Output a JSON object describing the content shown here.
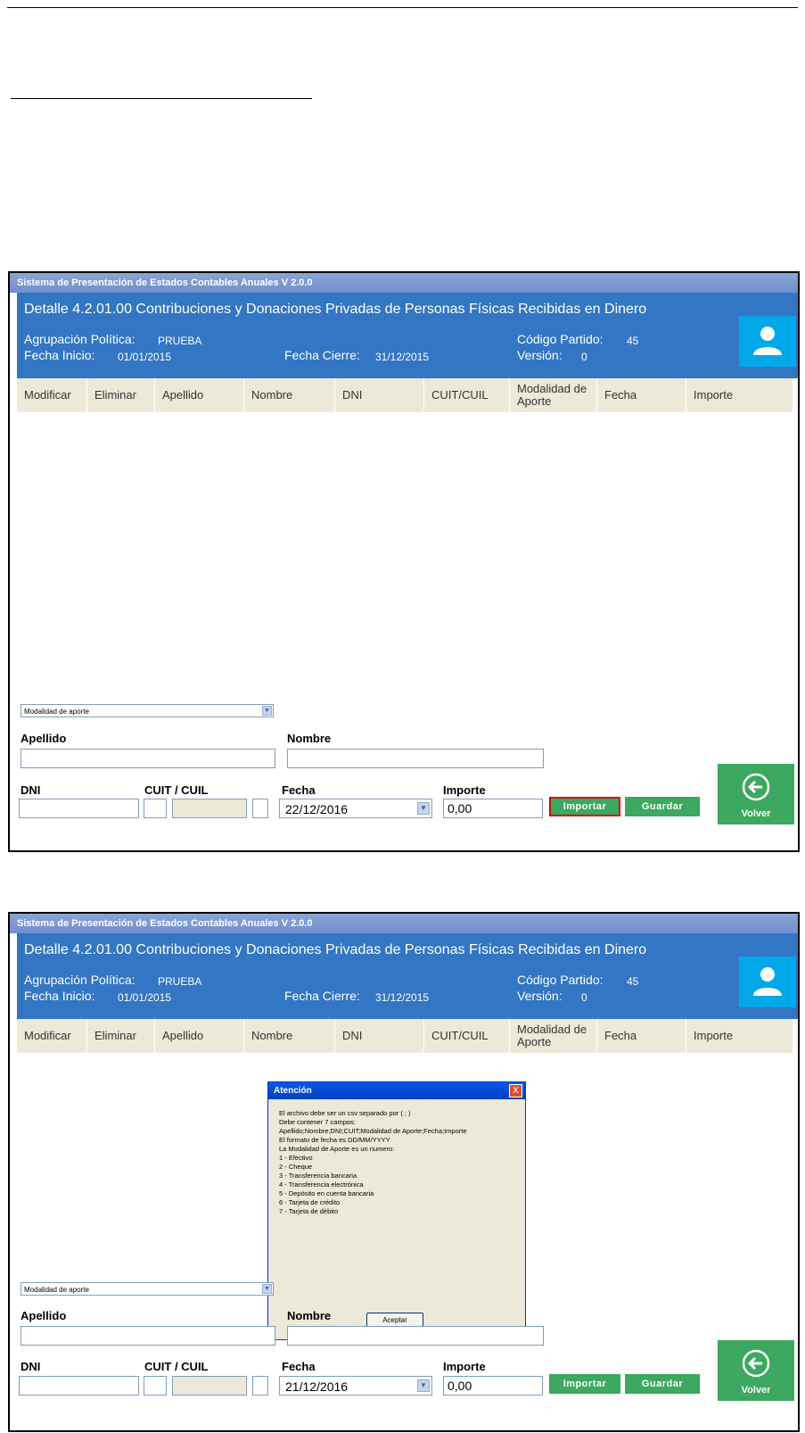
{
  "app": {
    "window_title": "Sistema de Presentación de Estados Contables Anuales V 2.0.0",
    "page_title": "Detalle 4.2.01.00 Contribuciones y Donaciones Privadas de Personas Físicas Recibidas en Dinero"
  },
  "header": {
    "agrupacion_label": "Agrupación Política:",
    "agrupacion_value": "PRUEBA",
    "fecha_inicio_label": "Fecha Inicio:",
    "fecha_inicio_value": "01/01/2015",
    "fecha_cierre_label": "Fecha Cierre:",
    "fecha_cierre_value": "31/12/2015",
    "codigo_label": "Código Partido:",
    "codigo_value": "45",
    "version_label": "Versión:",
    "version_value": "0",
    "user_icon": "user-icon"
  },
  "columns": [
    "Modificar",
    "Eliminar",
    "Apellido",
    "Nombre",
    "DNI",
    "CUIT/CUIL",
    "Modalidad de Aporte",
    "Fecha",
    "Importe"
  ],
  "form": {
    "modalidad_selected": "Modalidad de aporte",
    "apellido_label": "Apellido",
    "nombre_label": "Nombre",
    "dni_label": "DNI",
    "cuit_label": "CUIT / CUIL",
    "fecha_label": "Fecha",
    "importe_label": "Importe",
    "importe_value": "0,00",
    "importar_label": "Importar",
    "guardar_label": "Guardar",
    "volver_label": "Volver"
  },
  "screens": [
    {
      "fecha_value": "22/12/2016",
      "importar_highlighted": true
    },
    {
      "fecha_value": "21/12/2016",
      "importar_highlighted": false
    }
  ],
  "dialog": {
    "title": "Atención",
    "close_label": "X",
    "lines": [
      "El archivo debe ser un csv separado por ( ; )",
      "Debe contener 7 campos:",
      "Apellido;Nombre;DNI;CUIT;Modalidad de Aporte;Fecha;Importe",
      "El formato de fecha es DD/MM/YYYY",
      "La Modalidad de Aporte es un numero:",
      "1 - Efectivo",
      "2 - Cheque",
      "3 - Transferencia bancaria",
      "4 - Transferencia electrónica",
      "5 - Depósito en cuenta bancaria",
      "6 - Tarjeta de crédito",
      "7 - Tarjeta de débito"
    ],
    "ok_label": "Aceptar"
  },
  "colors": {
    "header_blue": "#3276c4",
    "user_tile": "#00a8e8",
    "button_green": "#3ca860",
    "highlight_red": "#e00000"
  }
}
